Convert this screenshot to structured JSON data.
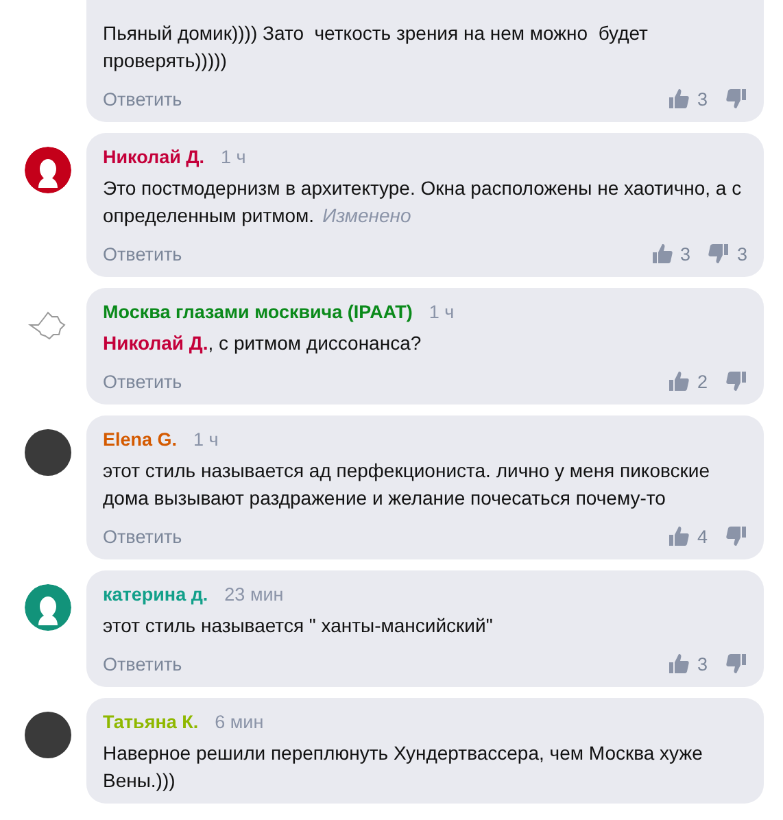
{
  "comments": [
    {
      "avatar": {
        "kind": "none"
      },
      "text": "Пьяный домик)))) Зато  четкость зрения на нем можно  будет проверять)))))",
      "reply_label": "Ответить",
      "likes": "3"
    },
    {
      "avatar": {
        "kind": "person",
        "color": "#c4001a"
      },
      "author": {
        "name": "Николай Д.",
        "color": "#c4003a"
      },
      "time": "1 ч",
      "text": "Это постмодернизм в архитектуре. Окна расположены не хаотично, а с определенным ритмом.",
      "edited": "Изменено",
      "reply_label": "Ответить",
      "likes": "3",
      "dislikes": "3"
    },
    {
      "avatar": {
        "kind": "outline"
      },
      "author": {
        "name": "Москва глазами москвича (IPAAT)",
        "color": "#0a8a1a"
      },
      "time": "1 ч",
      "mention": {
        "name": "Николай Д.",
        "color": "#c4003a"
      },
      "text": ", с ритмом диссонанса?",
      "reply_label": "Ответить",
      "likes": "2"
    },
    {
      "avatar": {
        "kind": "photo"
      },
      "author": {
        "name": "Elena G.",
        "color": "#d45a00"
      },
      "time": "1 ч",
      "text": "этот стиль называется ад перфекциониста. лично у меня пиковские дома вызывают раздражение и желание почесаться почему-то",
      "reply_label": "Ответить",
      "likes": "4"
    },
    {
      "avatar": {
        "kind": "person",
        "color": "#12937a"
      },
      "author": {
        "name": "катерина д.",
        "color": "#12a08a"
      },
      "time": "23 мин",
      "text": "этот стиль называется \" ханты-мансийский\"",
      "reply_label": "Ответить",
      "likes": "3"
    },
    {
      "avatar": {
        "kind": "photo"
      },
      "author": {
        "name": "Татьяна К.",
        "color": "#8fb800"
      },
      "time": "6 мин",
      "text": "Наверное решили переплюнуть Хундертвассера, чем Москва хуже Вены.)))"
    }
  ]
}
